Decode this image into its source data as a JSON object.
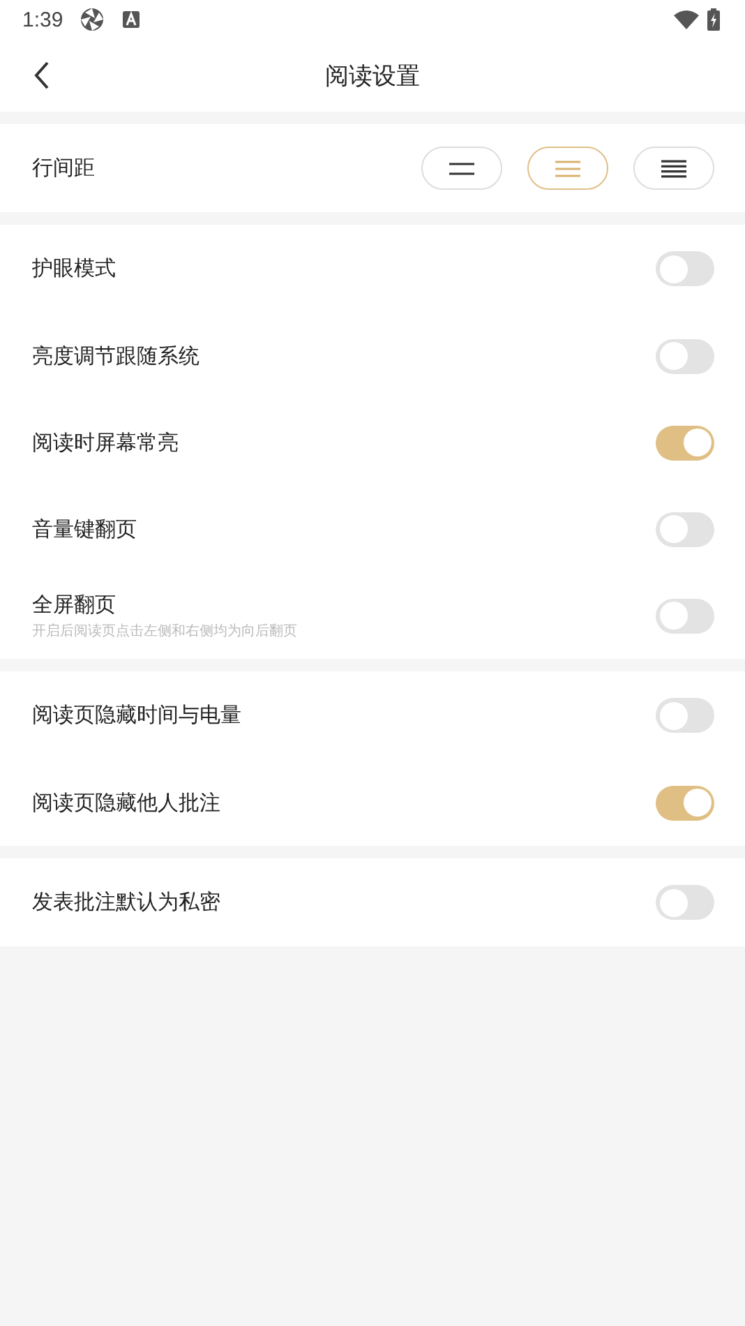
{
  "status_bar": {
    "time": "1:39"
  },
  "header": {
    "title": "阅读设置"
  },
  "line_spacing": {
    "label": "行间距",
    "options": [
      {
        "kind": "wide",
        "selected": false
      },
      {
        "kind": "medium",
        "selected": true
      },
      {
        "kind": "narrow",
        "selected": false
      }
    ]
  },
  "groups": [
    {
      "items": [
        {
          "label": "护眼模式",
          "on": false
        },
        {
          "label": "亮度调节跟随系统",
          "on": false
        },
        {
          "label": "阅读时屏幕常亮",
          "on": true
        },
        {
          "label": "音量键翻页",
          "on": false
        },
        {
          "label": "全屏翻页",
          "hint": "开启后阅读页点击左侧和右侧均为向后翻页",
          "on": false
        }
      ]
    },
    {
      "items": [
        {
          "label": "阅读页隐藏时间与电量",
          "on": false
        },
        {
          "label": "阅读页隐藏他人批注",
          "on": true
        }
      ]
    },
    {
      "items": [
        {
          "label": "发表批注默认为私密",
          "on": false
        }
      ]
    }
  ]
}
